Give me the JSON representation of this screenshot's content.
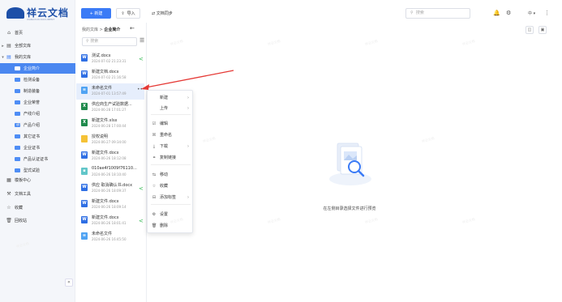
{
  "app": {
    "logo_text": "祥云文档",
    "logo_sub": "XIANGYUN DOCUMENT",
    "watermark": "祥云文档"
  },
  "sidebar": {
    "items": [
      {
        "label": "首页",
        "icon": "home-icon"
      },
      {
        "label": "全部文库",
        "icon": "library-icon"
      },
      {
        "label": "我的文库",
        "icon": "library-icon"
      },
      {
        "label": "企业简介"
      },
      {
        "label": "检测设备"
      },
      {
        "label": "制造装备"
      },
      {
        "label": "企业荣誉"
      },
      {
        "label": "产线介绍"
      },
      {
        "label": "产品介绍"
      },
      {
        "label": "其它证书"
      },
      {
        "label": "企业证书"
      },
      {
        "label": "产品认证证书"
      },
      {
        "label": "型式试验"
      },
      {
        "label": "模板中心",
        "icon": "template-icon"
      },
      {
        "label": "文档工具",
        "icon": "tools-icon"
      },
      {
        "label": "收藏",
        "icon": "star-icon"
      },
      {
        "label": "回收站",
        "icon": "trash-icon"
      }
    ],
    "collapse_glyph": "«"
  },
  "toolbar": {
    "new_label": "+ 新建",
    "import_label": "导入",
    "sync_label": "文档同步",
    "search_placeholder": "搜索",
    "lang_label": "中"
  },
  "breadcrumb": {
    "root": "我的文库",
    "sep": ">",
    "current": "企业简介"
  },
  "filelist": {
    "search_placeholder": "搜索",
    "files": [
      {
        "name": "测试.docx",
        "date": "2024-07-02 21:23:31",
        "type": "word",
        "shared": true
      },
      {
        "name": "新建文档.docx",
        "date": "2024-07-02 21:16:58",
        "type": "word",
        "shared": false
      },
      {
        "name": "未命名文件",
        "date": "2024-07-01 13:57:49",
        "type": "doc",
        "shared": false
      },
      {
        "name": "供应商生产试验数据...",
        "date": "2024-06-28 17:01:27",
        "type": "excel",
        "shared": false
      },
      {
        "name": "新建文件.xlsx",
        "date": "2024-06-28 17:00:44",
        "type": "excel",
        "shared": false
      },
      {
        "name": "授权说明",
        "date": "2024-06-27 09:34:00",
        "type": "folder",
        "shared": false
      },
      {
        "name": "新建文件.docx",
        "date": "2024-06-26 18:12:08",
        "type": "word",
        "shared": false
      },
      {
        "name": "010ae4f1009f76110...",
        "date": "2024-06-26 18:10:40",
        "type": "image",
        "shared": false
      },
      {
        "name": "供应 取消确认书.docx",
        "date": "2024-06-26 18:09:37",
        "type": "word",
        "shared": true
      },
      {
        "name": "新建文件.docx",
        "date": "2024-06-26 18:09:14",
        "type": "word",
        "shared": false
      },
      {
        "name": "新建文件.docx",
        "date": "2024-06-26 18:01:41",
        "type": "word",
        "shared": true
      },
      {
        "name": "未命名文件",
        "date": "2024-06-26 16:45:50",
        "type": "doc",
        "shared": false
      }
    ]
  },
  "context_menu": {
    "items": [
      {
        "label": "新建",
        "icon": "",
        "sub": "›"
      },
      {
        "label": "上传",
        "icon": "",
        "sub": "›"
      },
      {
        "label": "编辑",
        "icon": "☑",
        "sub": ""
      },
      {
        "label": "重命名",
        "icon": "☒",
        "sub": ""
      },
      {
        "label": "下载",
        "icon": "⤓",
        "sub": "›"
      },
      {
        "label": "复制链接",
        "icon": "⚭",
        "sub": ""
      },
      {
        "label": "移动",
        "icon": "⇆",
        "sub": ""
      },
      {
        "label": "收藏",
        "icon": "☆",
        "sub": ""
      },
      {
        "label": "添加标签",
        "icon": "⊟",
        "sub": "›"
      },
      {
        "label": "设置",
        "icon": "⚙",
        "sub": ""
      },
      {
        "label": "删除",
        "icon": "🗑",
        "sub": ""
      }
    ]
  },
  "preview": {
    "hint": "在左侧目录选择文件进行预览"
  },
  "colors": {
    "accent": "#3b7bf6",
    "sidebar_active": "#4a87f0",
    "share_green": "#2ab54a",
    "annotation_arrow": "#e53935"
  }
}
